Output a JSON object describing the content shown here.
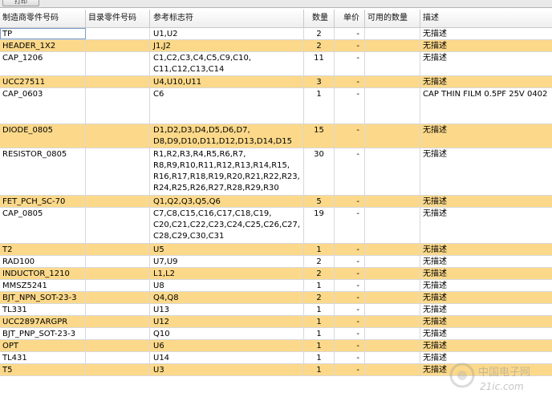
{
  "toolbar": {
    "button_label": "打印"
  },
  "table": {
    "columns": [
      "制造商零件号码",
      "目录零件号码",
      "参考标志符",
      "数量",
      "单价",
      "可用的数量",
      "描述"
    ],
    "rows": [
      {
        "mfr": "TP",
        "cat": "",
        "ref": "U1,U2",
        "qty": "2",
        "price": "-",
        "avail": "",
        "desc": "无描述",
        "hl": false,
        "h": 15
      },
      {
        "mfr": "HEADER_1X2",
        "cat": "",
        "ref": "J1,J2",
        "qty": "2",
        "price": "-",
        "avail": "",
        "desc": "无描述",
        "hl": true,
        "h": 15
      },
      {
        "mfr": "CAP_1206",
        "cat": "",
        "ref": "C1,C2,C3,C4,C5,C9,C10,\nC11,C12,C13,C14",
        "qty": "11",
        "price": "-",
        "avail": "",
        "desc": "无描述",
        "hl": false,
        "h": 30
      },
      {
        "mfr": "UCC27511",
        "cat": "",
        "ref": "U4,U10,U11",
        "qty": "3",
        "price": "-",
        "avail": "",
        "desc": "无描述",
        "hl": true,
        "h": 15
      },
      {
        "mfr": "CAP_0603",
        "cat": "",
        "ref": "C6",
        "qty": "1",
        "price": "-",
        "avail": "",
        "desc": "CAP THIN FILM 0.5PF 25V 0402",
        "hl": false,
        "h": 45
      },
      {
        "mfr": "DIODE_0805",
        "cat": "",
        "ref": "D1,D2,D3,D4,D5,D6,D7,\nD8,D9,D10,D11,D12,D13,D14,D15",
        "qty": "15",
        "price": "-",
        "avail": "",
        "desc": "无描述",
        "hl": true,
        "h": 30
      },
      {
        "mfr": "RESISTOR_0805",
        "cat": "",
        "ref": "R1,R2,R3,R4,R5,R6,R7,\nR8,R9,R10,R11,R12,R13,R14,R15,\nR16,R17,R18,R19,R20,R21,R22,R23,\nR24,R25,R26,R27,R28,R29,R30",
        "qty": "30",
        "price": "-",
        "avail": "",
        "desc": "无描述",
        "hl": false,
        "h": 59
      },
      {
        "mfr": "FET_PCH_SC-70",
        "cat": "",
        "ref": "Q1,Q2,Q3,Q5,Q6",
        "qty": "5",
        "price": "-",
        "avail": "",
        "desc": "无描述",
        "hl": true,
        "h": 15
      },
      {
        "mfr": "CAP_0805",
        "cat": "",
        "ref": "C7,C8,C15,C16,C17,C18,C19,\nC20,C21,C22,C23,C24,C25,C26,C27,\nC28,C29,C30,C31",
        "qty": "19",
        "price": "-",
        "avail": "",
        "desc": "无描述",
        "hl": false,
        "h": 45
      },
      {
        "mfr": "T2",
        "cat": "",
        "ref": "U5",
        "qty": "1",
        "price": "-",
        "avail": "",
        "desc": "无描述",
        "hl": true,
        "h": 15
      },
      {
        "mfr": "RAD100",
        "cat": "",
        "ref": "U7,U9",
        "qty": "2",
        "price": "-",
        "avail": "",
        "desc": "无描述",
        "hl": false,
        "h": 15
      },
      {
        "mfr": "INDUCTOR_1210",
        "cat": "",
        "ref": "L1,L2",
        "qty": "2",
        "price": "-",
        "avail": "",
        "desc": "无描述",
        "hl": true,
        "h": 15
      },
      {
        "mfr": "MMSZ5241",
        "cat": "",
        "ref": "U8",
        "qty": "1",
        "price": "-",
        "avail": "",
        "desc": "无描述",
        "hl": false,
        "h": 15
      },
      {
        "mfr": "BJT_NPN_SOT-23-3",
        "cat": "",
        "ref": "Q4,Q8",
        "qty": "2",
        "price": "-",
        "avail": "",
        "desc": "无描述",
        "hl": true,
        "h": 15
      },
      {
        "mfr": "TL331",
        "cat": "",
        "ref": "U13",
        "qty": "1",
        "price": "-",
        "avail": "",
        "desc": "无描述",
        "hl": false,
        "h": 15
      },
      {
        "mfr": "UCC2897ARGPR",
        "cat": "",
        "ref": "U12",
        "qty": "1",
        "price": "-",
        "avail": "",
        "desc": "无描述",
        "hl": true,
        "h": 15
      },
      {
        "mfr": "BJT_PNP_SOT-23-3",
        "cat": "",
        "ref": "Q10",
        "qty": "1",
        "price": "-",
        "avail": "",
        "desc": "无描述",
        "hl": false,
        "h": 15
      },
      {
        "mfr": "OPT",
        "cat": "",
        "ref": "U6",
        "qty": "1",
        "price": "-",
        "avail": "",
        "desc": "无描述",
        "hl": true,
        "h": 15
      },
      {
        "mfr": "TL431",
        "cat": "",
        "ref": "U14",
        "qty": "1",
        "price": "-",
        "avail": "",
        "desc": "无描述",
        "hl": false,
        "h": 15
      },
      {
        "mfr": "T5",
        "cat": "",
        "ref": "U3",
        "qty": "1",
        "price": "-",
        "avail": "",
        "desc": "无描述",
        "hl": true,
        "h": 15
      }
    ]
  },
  "watermark": {
    "cn": "中国电子网",
    "en": "21ic.com"
  },
  "colors": {
    "highlight_row": "#fcd98a",
    "grid_line": "#d8d8d8"
  }
}
